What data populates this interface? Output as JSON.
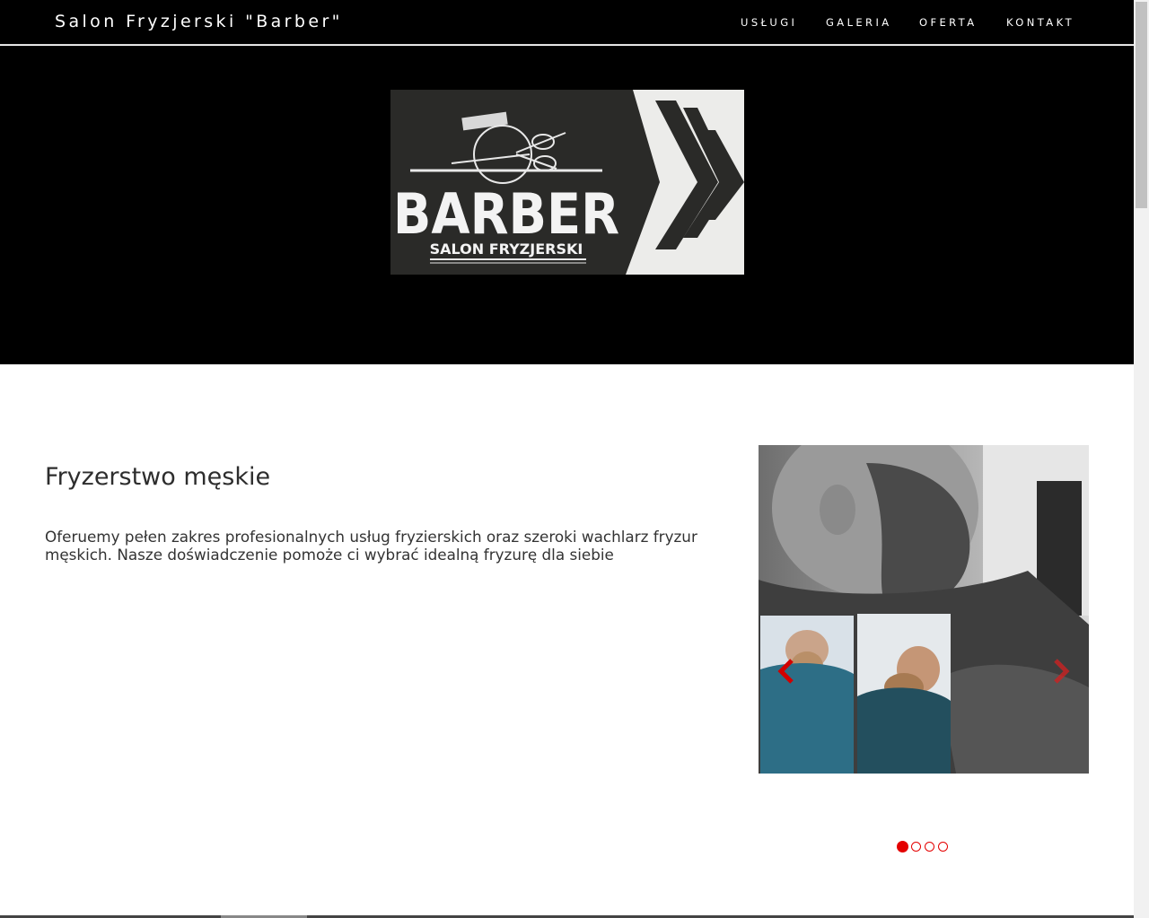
{
  "header": {
    "brand": "Salon Fryzjerski \"Barber\"",
    "nav": [
      "USŁUGI",
      "GALERIA",
      "OFERTA",
      "KONTAKT"
    ]
  },
  "hero": {
    "logo_title": "BARBER",
    "logo_subtitle": "SALON FRYZJERSKI"
  },
  "main": {
    "heading": "Fryzerstwo męskie",
    "description": "Oferuemy pełen zakres profesionalnych usług fryzierskich oraz szeroki wachlarz fryzur męskich. Nasze doświadczenie pomoże ci wybrać idealną fryzurę dla siebie"
  },
  "carousel": {
    "slide_count": 4,
    "active_slide": 1
  },
  "colors": {
    "accent": "#e40000",
    "nav_bg": "#000000",
    "text": "#333333"
  }
}
